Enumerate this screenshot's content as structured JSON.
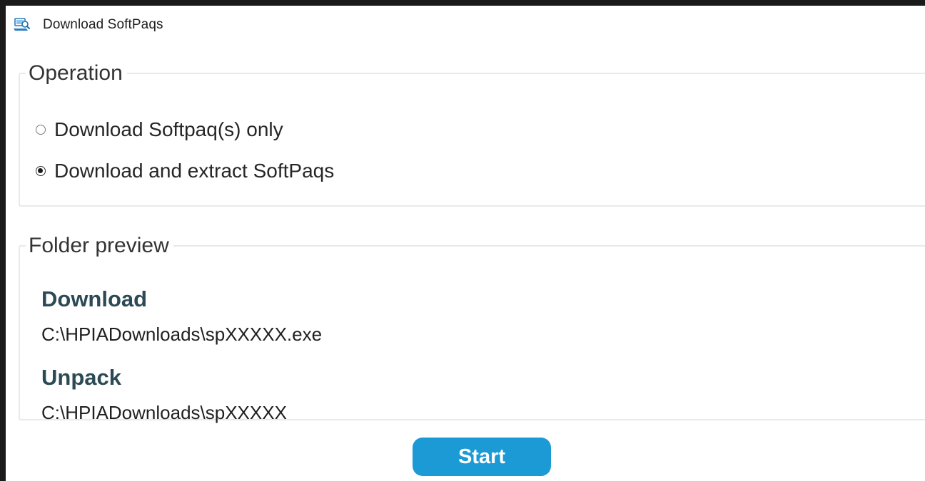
{
  "window": {
    "title": "Download SoftPaqs",
    "icon": "download-softpaq-app-icon"
  },
  "operation": {
    "legend": "Operation",
    "options": [
      {
        "label": "Download Softpaq(s) only",
        "selected": false
      },
      {
        "label": "Download and extract SoftPaqs",
        "selected": true
      }
    ]
  },
  "folder_preview": {
    "legend": "Folder preview",
    "download_heading": "Download",
    "download_path": "C:\\HPIADownloads\\spXXXXX.exe",
    "unpack_heading": "Unpack",
    "unpack_path": "C:\\HPIADownloads\\spXXXXX"
  },
  "actions": {
    "start_label": "Start"
  },
  "colors": {
    "accent": "#1b9ad6",
    "heading": "#2c4a55",
    "group_border": "#e9e9e9"
  }
}
